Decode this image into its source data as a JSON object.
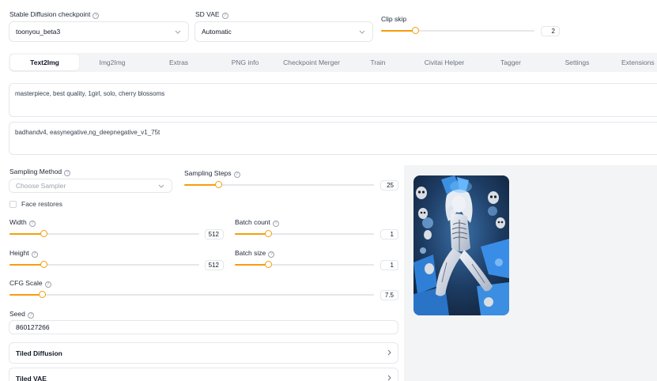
{
  "top": {
    "checkpoint": {
      "label": "Stable Diffusion checkpoint",
      "value": "toonyou_beta3"
    },
    "vae": {
      "label": "SD VAE",
      "value": "Automatic"
    },
    "clip_skip": {
      "label": "Clip skip",
      "value": "2",
      "fraction": 0.22
    }
  },
  "tabs": [
    {
      "label": "Text2Img",
      "active": true
    },
    {
      "label": "Img2Img"
    },
    {
      "label": "Extras"
    },
    {
      "label": "PNG info"
    },
    {
      "label": "Checkpoint Merger"
    },
    {
      "label": "Train"
    },
    {
      "label": "Civitai Helper"
    },
    {
      "label": "Tagger"
    },
    {
      "label": "Settings"
    },
    {
      "label": "Extensions"
    }
  ],
  "prompt": {
    "value": "masterpiece, best quality, 1girl, solo, cherry blossoms"
  },
  "negative_prompt": {
    "value": "badhandv4, easynegative,ng_deepnegative_v1_75t"
  },
  "sampling_method": {
    "label": "Sampling Method",
    "placeholder": "Choose Sampler"
  },
  "sampling_steps": {
    "label": "Sampling Steps",
    "value": "25",
    "fraction": 0.18
  },
  "face_restores": {
    "label": "Face restores",
    "checked": false
  },
  "width": {
    "label": "Width",
    "value": "512",
    "fraction": 0.18
  },
  "height": {
    "label": "Height",
    "value": "512",
    "fraction": 0.18
  },
  "batch_count": {
    "label": "Batch count",
    "value": "1",
    "fraction": 0.24
  },
  "batch_size": {
    "label": "Batch size",
    "value": "1",
    "fraction": 0.24
  },
  "cfg_scale": {
    "label": "CFG Scale",
    "value": "7.5",
    "fraction": 0.09
  },
  "seed": {
    "label": "Seed",
    "value": "860127266"
  },
  "accordions": [
    {
      "label": "Tiled Diffusion"
    },
    {
      "label": "Tiled VAE"
    }
  ],
  "preview": {
    "subject": "generated-image-skeleton-girl"
  },
  "colors": {
    "accent": "#f59e0b",
    "border": "#e5e7eb",
    "panel": "#f3f4f6"
  }
}
